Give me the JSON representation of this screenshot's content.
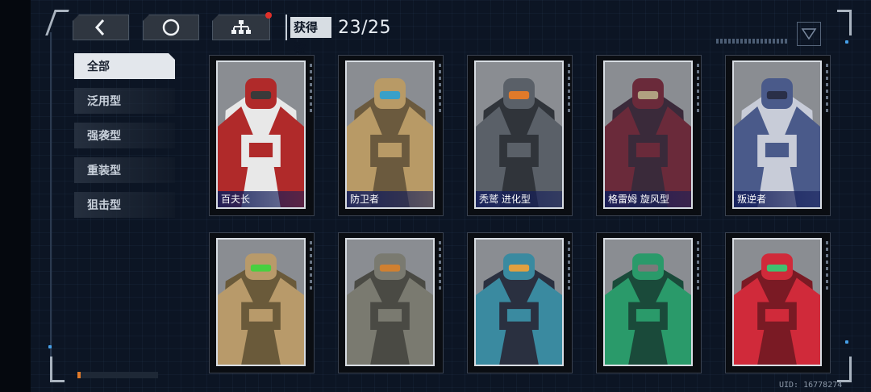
{
  "header": {
    "back_icon": "chevron-left-icon",
    "home_icon": "circle-icon",
    "tree_icon": "hierarchy-icon",
    "count_label": "获得数",
    "count_value": "23/25"
  },
  "sidebar": {
    "items": [
      {
        "label": "全部",
        "active": true
      },
      {
        "label": "泛用型",
        "active": false
      },
      {
        "label": "强袭型",
        "active": false
      },
      {
        "label": "重装型",
        "active": false
      },
      {
        "label": "狙击型",
        "active": false
      }
    ]
  },
  "cards": [
    {
      "name": "百夫长",
      "colors": [
        "#b02a2a",
        "#e8e8e8",
        "#3a3a3a"
      ]
    },
    {
      "name": "防卫者",
      "colors": [
        "#b89a66",
        "#6b5a3e",
        "#38a0c8"
      ]
    },
    {
      "name": "秃鹫 进化型",
      "colors": [
        "#5a6068",
        "#30343a",
        "#e07a2a"
      ]
    },
    {
      "name": "格雷姆 旋风型",
      "colors": [
        "#6a2a3a",
        "#3a2a3a",
        "#b0a080"
      ]
    },
    {
      "name": "叛逆者",
      "colors": [
        "#4a5a8a",
        "#c8ccd8",
        "#2a2f48"
      ]
    },
    {
      "name": "",
      "colors": [
        "#b89a6a",
        "#6a5a3a",
        "#48d040"
      ]
    },
    {
      "name": "",
      "colors": [
        "#7a7a70",
        "#4a4a44",
        "#d08030"
      ]
    },
    {
      "name": "",
      "colors": [
        "#3a8aa0",
        "#2a3040",
        "#e0a040"
      ]
    },
    {
      "name": "",
      "colors": [
        "#2a9a6a",
        "#1a4a3a",
        "#7a7a7a"
      ]
    },
    {
      "name": "",
      "colors": [
        "#d02a3a",
        "#7a1a24",
        "#40c070"
      ]
    }
  ],
  "footer": {
    "uid": "UID: 16778274"
  }
}
